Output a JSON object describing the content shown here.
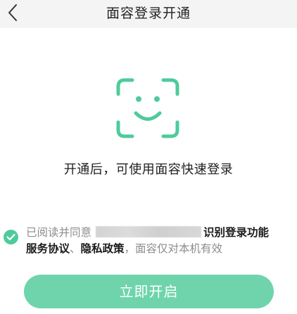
{
  "navbar": {
    "title": "面容登录开通",
    "back_icon": "chevron-left-icon"
  },
  "hero": {
    "icon": "face-id-icon",
    "accent_color": "#4ecb9b",
    "headline": "开通后，可使用面容快速登录"
  },
  "agreement": {
    "checked": true,
    "prefix": "已阅读并同意",
    "service_link": "识别登录功能服务协议",
    "separator": "、",
    "privacy_link": "隐私政策",
    "suffix": "，面容仅对本机有效"
  },
  "actions": {
    "primary_label": "立即开启",
    "primary_color": "#6fd4ac"
  }
}
